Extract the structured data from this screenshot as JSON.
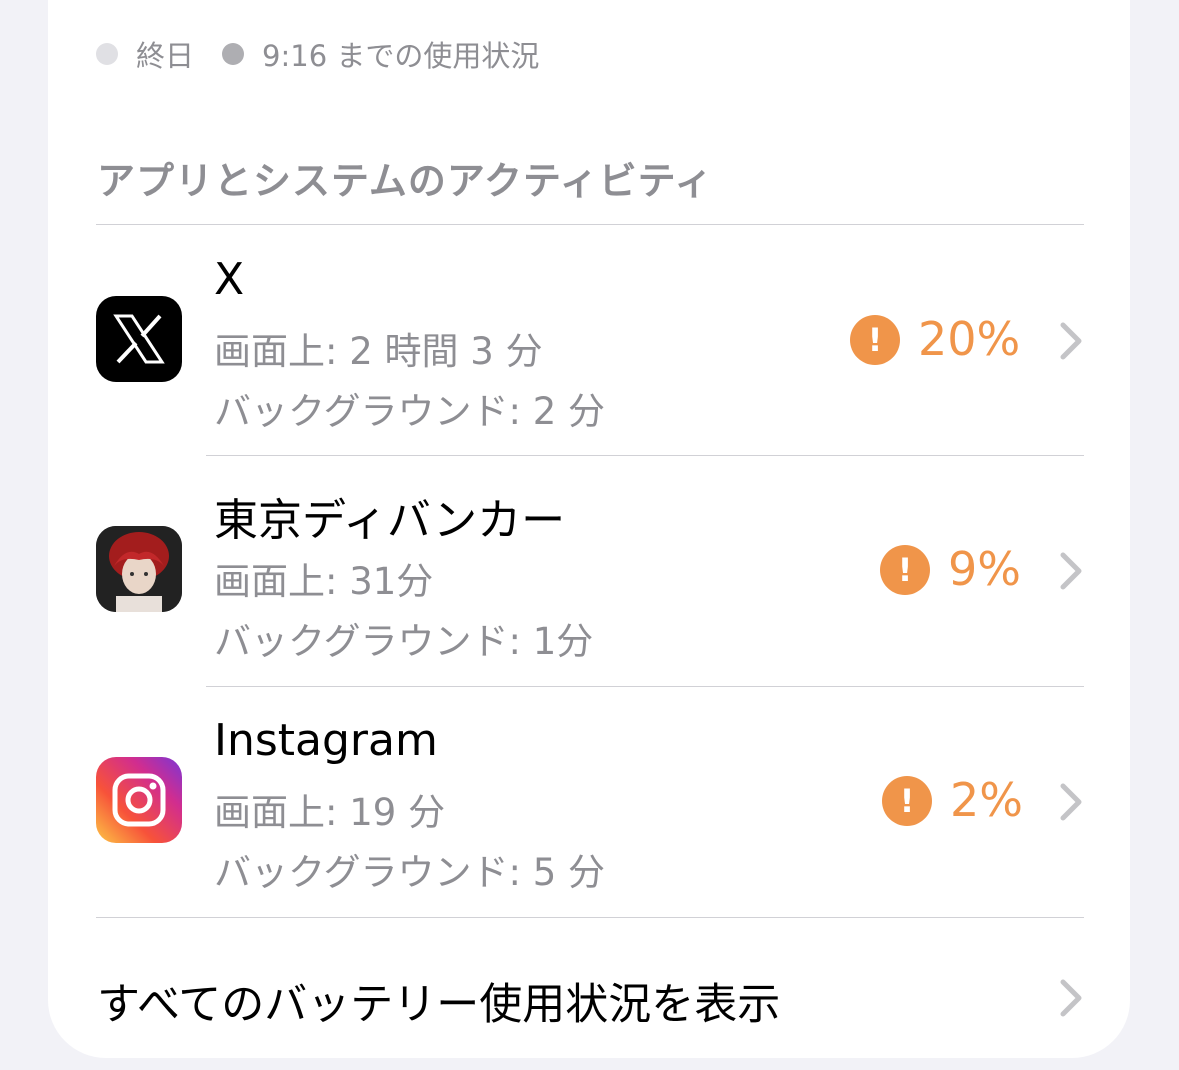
{
  "legend": {
    "all_day": "終日",
    "usage_until": "9:16 までの使用状況"
  },
  "section_title": "アプリとシステムのアクティビティ",
  "apps": [
    {
      "name": "X",
      "screen_time": "画面上: 2 時間 3 分",
      "background_time": "バックグラウンド: 2 分",
      "percent": "20%",
      "icon": "x-logo-icon"
    },
    {
      "name": "東京ディバンカー",
      "screen_time": "画面上: 31分",
      "background_time": "バックグラウンド: 1分",
      "percent": "9%",
      "icon": "tokyo-debunker-icon"
    },
    {
      "name": "Instagram",
      "screen_time": "画面上: 19 分",
      "background_time": "バックグラウンド: 5 分",
      "percent": "2%",
      "icon": "instagram-icon"
    }
  ],
  "warning_glyph": "!",
  "footer_link": "すべてのバッテリー使用状況を表示",
  "colors": {
    "warning": "#f0954a",
    "secondary_text": "#8e8e93",
    "background": "#f2f2f7"
  }
}
